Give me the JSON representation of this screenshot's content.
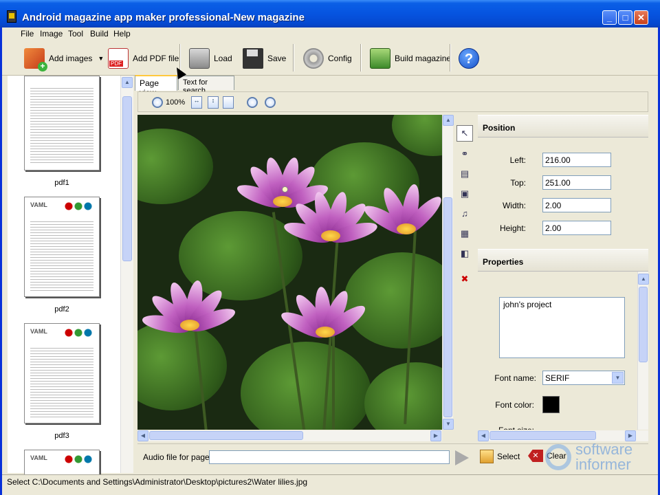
{
  "window": {
    "title": "Android magazine app maker professional-New magazine",
    "controls": {
      "minimize": "_",
      "maximize": "□",
      "close": "✕"
    }
  },
  "menu": [
    "File",
    "Image",
    "Tool",
    "Build",
    "Help"
  ],
  "toolbar": {
    "add_images": "Add images",
    "add_pdf": "Add PDF file",
    "load": "Load",
    "save": "Save",
    "config": "Config",
    "build": "Build magazine",
    "help_glyph": "?",
    "pdf_badge": "PDF",
    "dropdown_glyph": "▼"
  },
  "pages": [
    {
      "label": "pdf1"
    },
    {
      "label": "pdf2",
      "logo": "VAML"
    },
    {
      "label": "pdf3",
      "logo": "VAML"
    },
    {
      "label": "",
      "logo": "VAML"
    }
  ],
  "tabs": {
    "page_view": "Page view",
    "text_search": "Text for search"
  },
  "view_toolbar": {
    "zoom": "100%"
  },
  "position": {
    "heading": "Position",
    "left_label": "Left:",
    "left": "216.00",
    "top_label": "Top:",
    "top": "251.00",
    "width_label": "Width:",
    "width": "2.00",
    "height_label": "Height:",
    "height": "2.00"
  },
  "properties": {
    "heading": "Properties",
    "text": "john's project",
    "font_name_label": "Font name:",
    "font_name": "SERIF",
    "font_color_label": "Font color:",
    "font_color": "#000000",
    "font_size_label": "Font size:"
  },
  "audio": {
    "label": "Audio file for page:",
    "value": "",
    "select": "Select",
    "clear": "Clear"
  },
  "status": "Select C:\\Documents and Settings\\Administrator\\Desktop\\pictures2\\Water lilies.jpg",
  "watermark": {
    "line1": "software",
    "line2": "informer"
  },
  "colors": {
    "titlebar": "#0654e0",
    "chrome": "#ece9d8",
    "accent_tab": "#ffc83c"
  }
}
